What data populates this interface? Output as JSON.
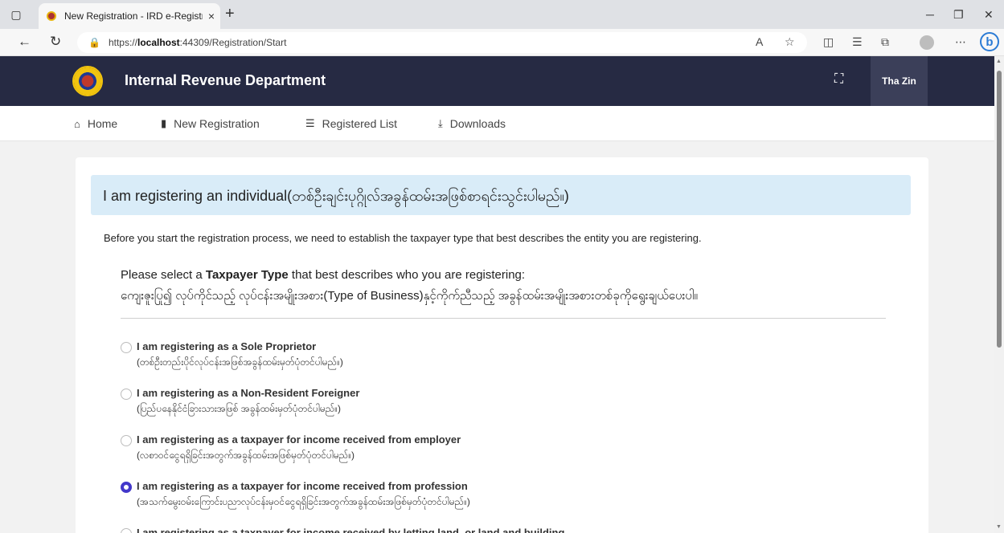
{
  "browser": {
    "tab_title": "New Registration - IRD e-Registr",
    "tab_close": "×",
    "new_tab": "+",
    "url_prefix": "https://",
    "url_host": "localhost",
    "url_path": ":44309/Registration/Start"
  },
  "header": {
    "brand": "Internal Revenue Department",
    "user": "Tha Zin"
  },
  "menu": {
    "home": "Home",
    "new_registration": "New Registration",
    "registered_list": "Registered List",
    "downloads": "Downloads"
  },
  "main": {
    "alert": "I am registering an individual(တစ်ဦးချင်းပုဂ္ဂိုလ်အခွန်ထမ်းအဖြစ်စာရင်းသွင်းပါမည်။)",
    "intro": "Before you start the registration process, we need to establish the taxpayer type that best describes the entity you are registering.",
    "prompt_pre": "Please select a ",
    "prompt_bold": "Taxpayer Type",
    "prompt_post": " that best describes who you are registering:",
    "prompt_my": "ကျေးဇူးပြု၍ လုပ်ကိုင်သည့် လုပ်ငန်းအမျိုးအစား(Type of Business)နှင့်ကိုက်ညီသည့် အခွန်ထမ်းအမျိုးအစားတစ်ခုကိုရွေးချယ်ပေးပါ။",
    "options": [
      {
        "title": "I am registering as a Sole Proprietor",
        "sub": "(တစ်ဦးတည်းပိုင်လုပ်ငန်းအဖြစ်အခွန်ထမ်းမှတ်ပုံတင်ပါမည်။)",
        "checked": false
      },
      {
        "title": "I am registering as a Non-Resident Foreigner",
        "sub": "(ပြည်ပနေနိုင်ငံခြားသားအဖြစ် အခွန်ထမ်းမှတ်ပုံတင်ပါမည်။)",
        "checked": false
      },
      {
        "title": "I am registering as a taxpayer for income received from employer",
        "sub": "(လစာဝင်ငွေရရှိခြင်းအတွက်အခွန်ထမ်းအဖြစ်မှတ်ပုံတင်ပါမည်။)",
        "checked": false
      },
      {
        "title": "I am registering as a taxpayer for income received from profession",
        "sub": "(အသက်မွေးဝမ်းကြောင်းပညာလုပ်ငန်းမှဝင်ငွေရရှိခြင်းအတွက်အခွန်ထမ်းအဖြစ်မှတ်ပုံတင်ပါမည်။)",
        "checked": true
      },
      {
        "title": "I am registering as a taxpayer for income received by letting land, or land and building",
        "sub": "",
        "checked": false
      }
    ]
  }
}
